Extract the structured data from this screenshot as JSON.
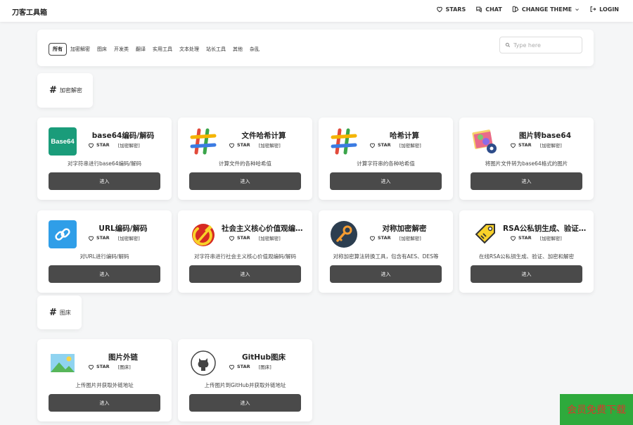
{
  "header": {
    "brand": "刀客工具箱",
    "nav": [
      {
        "label": "STARS",
        "icon": "heart-icon"
      },
      {
        "label": "CHAT",
        "icon": "chat-icon"
      },
      {
        "label": "CHANGE THEME",
        "icon": "theme-icon"
      },
      {
        "label": "LOGIN",
        "icon": "login-icon"
      }
    ]
  },
  "filter": {
    "categories": [
      "所有",
      "加密解密",
      "图床",
      "开发类",
      "翻译",
      "实用工具",
      "文本处理",
      "站长工具",
      "其他",
      "杂乱"
    ],
    "active": "所有",
    "search_placeholder": "Type here"
  },
  "sections": [
    {
      "title": "加密解密",
      "tools": [
        {
          "title": "base64编码/解码",
          "tag": "[加密解密]",
          "desc": "对字符串进行base64编码/解码",
          "button": "进入",
          "icon": "base64-icon",
          "icon_text": "Base64"
        },
        {
          "title": "文件哈希计算",
          "tag": "[加密解密]",
          "desc": "计算文件的各种哈希值",
          "button": "进入",
          "icon": "hash-icon"
        },
        {
          "title": "哈希计算",
          "tag": "[加密解密]",
          "desc": "计算字符串的各种哈希值",
          "button": "进入",
          "icon": "hash-icon"
        },
        {
          "title": "图片转base64",
          "tag": "[加密解密]",
          "desc": "将图片文件转为base64格式的图片",
          "button": "进入",
          "icon": "image-convert-icon"
        },
        {
          "title": "URL编码/解码",
          "tag": "[加密解密]",
          "desc": "对URL进行编码/解码",
          "button": "进入",
          "icon": "link-icon"
        },
        {
          "title": "社会主义核心价值观编码/解码",
          "tag": "[加密解密]",
          "desc": "对字符串进行社会主义核心价值观编码/解码",
          "button": "进入",
          "icon": "hammer-sickle-icon"
        },
        {
          "title": "对称加密解密",
          "tag": "[加密解密]",
          "desc": "对称加密算法转换工具，包含有AES、DES等",
          "button": "进入",
          "icon": "key-icon"
        },
        {
          "title": "RSA公私钥生成、验证、加密和解密",
          "tag": "[加密解密]",
          "desc": "在线RSA公私钥生成、验证、加密和解密",
          "button": "进入",
          "icon": "tag-key-icon"
        }
      ]
    },
    {
      "title": "图床",
      "tools": [
        {
          "title": "图片外链",
          "tag": "[图床]",
          "desc": "上传图片并获取外链地址",
          "button": "进入",
          "icon": "picture-icon"
        },
        {
          "title": "GitHub图床",
          "tag": "[图床]",
          "desc": "上传图片到GitHub并获取外链地址",
          "button": "进入",
          "icon": "github-icon"
        }
      ]
    }
  ],
  "star_label": "STAR",
  "vip_banner": "会员免费下载",
  "colors": {
    "button": "#4a4a4a",
    "vip_bg": "#2eaa3c",
    "vip_text": "#d6392c"
  }
}
